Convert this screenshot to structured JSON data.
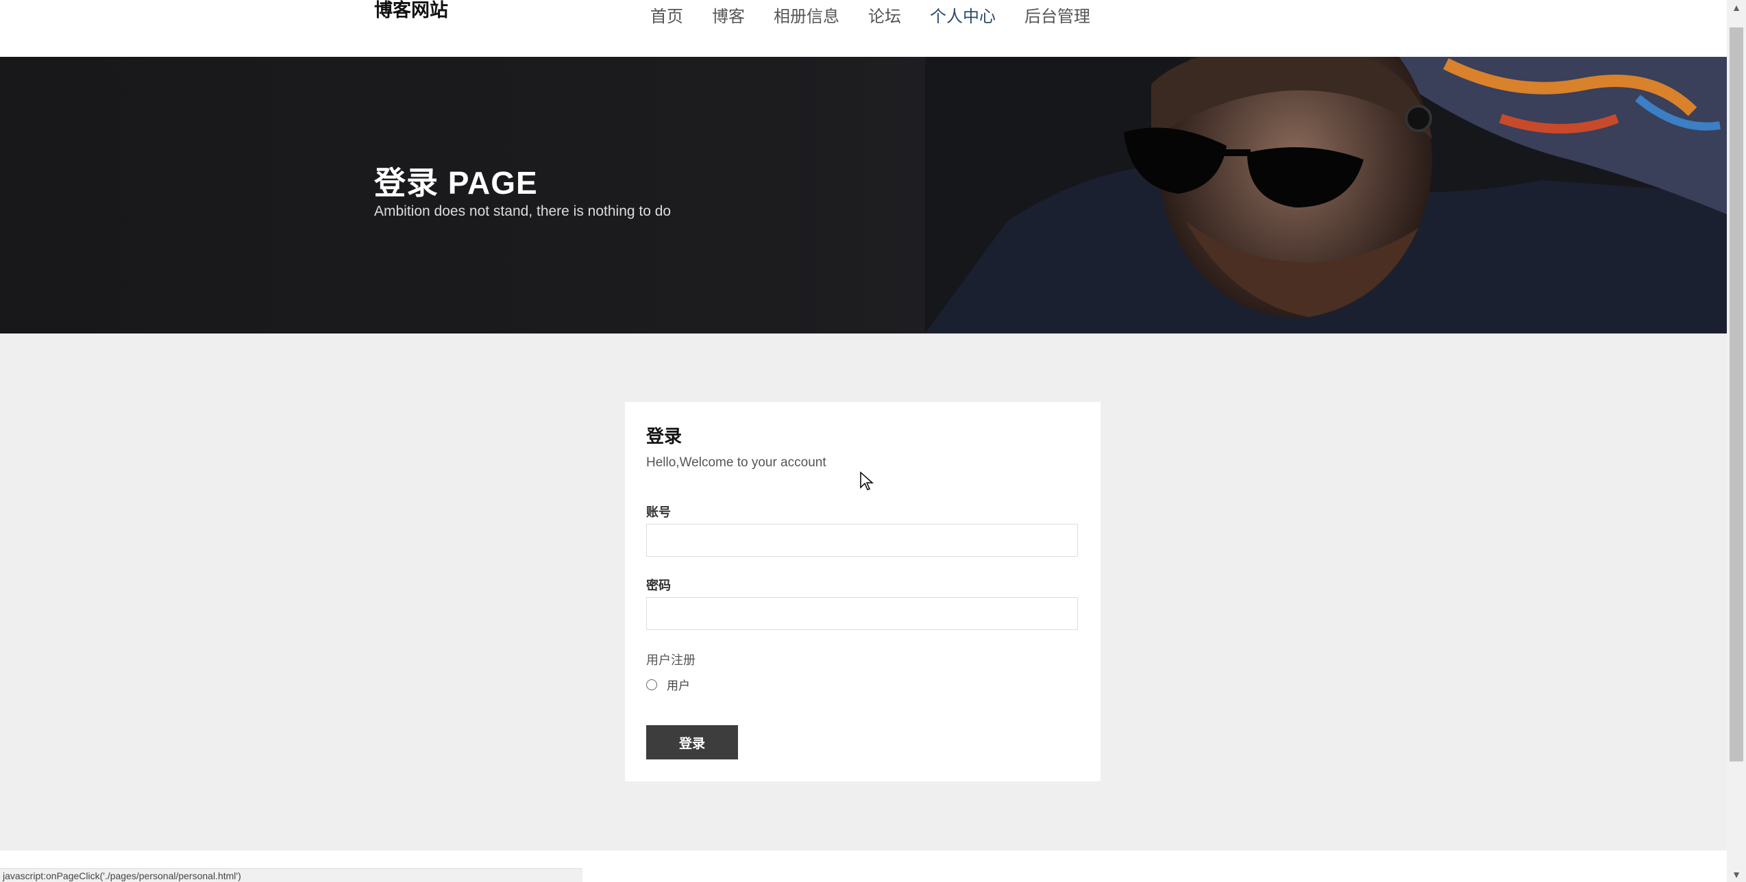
{
  "header": {
    "logo": "博客网站",
    "nav": [
      "首页",
      "博客",
      "相册信息",
      "论坛",
      "个人中心",
      "后台管理"
    ],
    "active_nav": "个人中心"
  },
  "hero": {
    "title": "登录 PAGE",
    "subtitle": "Ambition does not stand, there is nothing to do"
  },
  "login": {
    "title": "登录",
    "subtitle": "Hello,Welcome to your account",
    "account_label": "账号",
    "account_value": "",
    "password_label": "密码",
    "password_value": "",
    "register_label": "用户注册",
    "role_option": "用户",
    "submit_label": "登录"
  },
  "status_bar": {
    "url": "javascript:onPageClick('./pages/personal/personal.html')"
  },
  "colors": {
    "active_nav": "#2b4a6b",
    "button": "#3d3d3d",
    "page_bg": "#efefef"
  }
}
